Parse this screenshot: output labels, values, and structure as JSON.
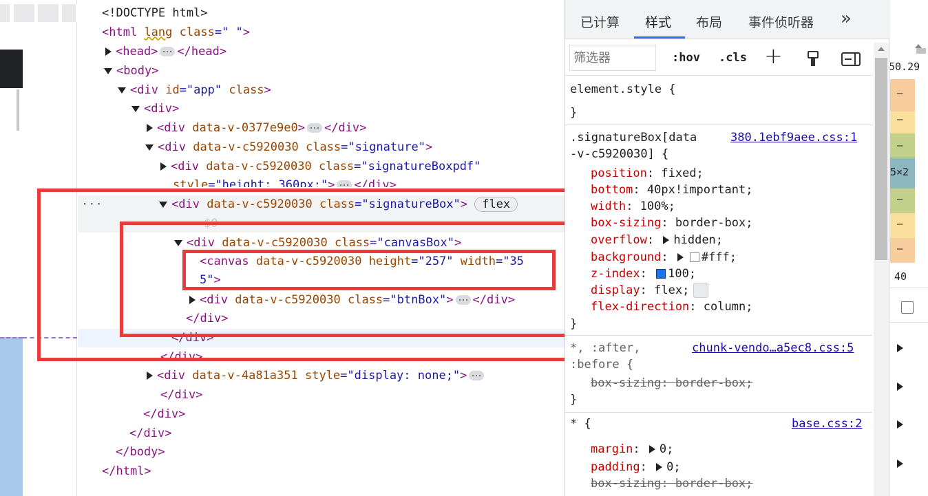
{
  "dom": {
    "doctype": "<!DOCTYPE html>",
    "html_open_tag": "<html",
    "html_lang_attr": "lang",
    "html_class_attr": "class",
    "html_class_val": "=\" \"",
    "head_open": "<head>",
    "head_close": "</head>",
    "body_open": "<body>",
    "app_div_open": "<div",
    "app_id": "id",
    "app_id_val": "=\"app\"",
    "app_class": "class",
    "app_close": ">",
    "div_open": "<div>",
    "div_0377_open": "<div",
    "div_0377_attr": "data-v-0377e9e0",
    "div_0377_close": ">",
    "div_close": "</div>",
    "sig_div_open": "<div",
    "sig_attr": "data-v-c5920030",
    "sig_class": "class",
    "sig_class_val": "=\"signature\"",
    "sig_close": ">",
    "pdf_div_open": "<div",
    "pdf_attr": "data-v-c5920030",
    "pdf_class": "class",
    "pdf_class_val": "=\"signatureBoxpdf\"",
    "pdf_style": "style",
    "pdf_style_val": "=\"height: 360px;\"",
    "pdf_close": ">",
    "box_div_open": "<div",
    "box_attr": "data-v-c5920030",
    "box_class": "class",
    "box_class_val": "=\"signatureBox\"",
    "box_close": ">",
    "flex_badge": "flex",
    "dollar0": "$0",
    "row_dots": "···",
    "canvasbox_open": "<div",
    "canvasbox_attr": "data-v-c5920030",
    "canvasbox_class": "class",
    "canvasbox_class_val": "=\"canvasBox\"",
    "canvasbox_close": ">",
    "canvas_open": "<canvas",
    "canvas_attr": "data-v-c5920030",
    "canvas_height": "height",
    "canvas_height_val": "=\"257\"",
    "canvas_width": "width",
    "canvas_width_val_a": "=\"35",
    "canvas_width_val_b": "5\"",
    "canvas_close": ">",
    "btnbox_open": "<div",
    "btnbox_attr": "data-v-c5920030",
    "btnbox_class": "class",
    "btnbox_class_val": "=\"btnBox\"",
    "btnbox_close": ">",
    "div4a81_open": "<div",
    "div4a81_attr": "data-v-4a81a351",
    "div4a81_style": "style",
    "div4a81_style_val": "=\"display: none;\"",
    "div4a81_close": ">",
    "body_close": "</body>",
    "html_close": "</html>"
  },
  "styles_panel": {
    "tabs": [
      "已计算",
      "样式",
      "布局",
      "事件侦听器"
    ],
    "more": "»",
    "filter_placeholder": "筛选器",
    "hov": ":hov",
    "cls": ".cls",
    "plus": "+",
    "element_style_sel": "element.style {",
    "brace_close": "}",
    "rule1_sel_a": ".signatureBox[data",
    "rule1_sel_b": "-v-c5920030] {",
    "rule1_src": "380.1ebf9aee.css:1",
    "rule1_props": [
      {
        "name": "position",
        "value": "fixed;"
      },
      {
        "name": "bottom",
        "value": "40px!important;"
      },
      {
        "name": "width",
        "value": "100%;"
      },
      {
        "name": "box-sizing",
        "value": "border-box;"
      },
      {
        "name": "overflow",
        "value": "hidden;"
      },
      {
        "name": "background",
        "value": "#fff;"
      },
      {
        "name": "z-index",
        "value": "100;"
      },
      {
        "name": "display",
        "value": "flex;"
      },
      {
        "name": "flex-direction",
        "value": "column;"
      }
    ],
    "rule2_sel_a": "*, :after,",
    "rule2_sel_b": ":before {",
    "rule2_src": "chunk-vendo…a5ec8.css:5",
    "rule2_prop": "box-sizing: border-box;",
    "rule3_sel": "* {",
    "rule3_src": "base.css:2",
    "rule3_props": [
      {
        "name": "margin",
        "value": "0;"
      },
      {
        "name": "padding",
        "value": "0;"
      }
    ],
    "rule3_struck": "box-sizing: border-box;"
  },
  "right_strip": {
    "top_val": "50.29",
    "mid_val": "5×2",
    "bottom_val": "40",
    "dash": "–"
  },
  "colors": {
    "annotation_red": "#e83c3c",
    "tag": "#881280",
    "attr": "#994500",
    "value": "#1a1aa6",
    "prop": "#c80000"
  }
}
